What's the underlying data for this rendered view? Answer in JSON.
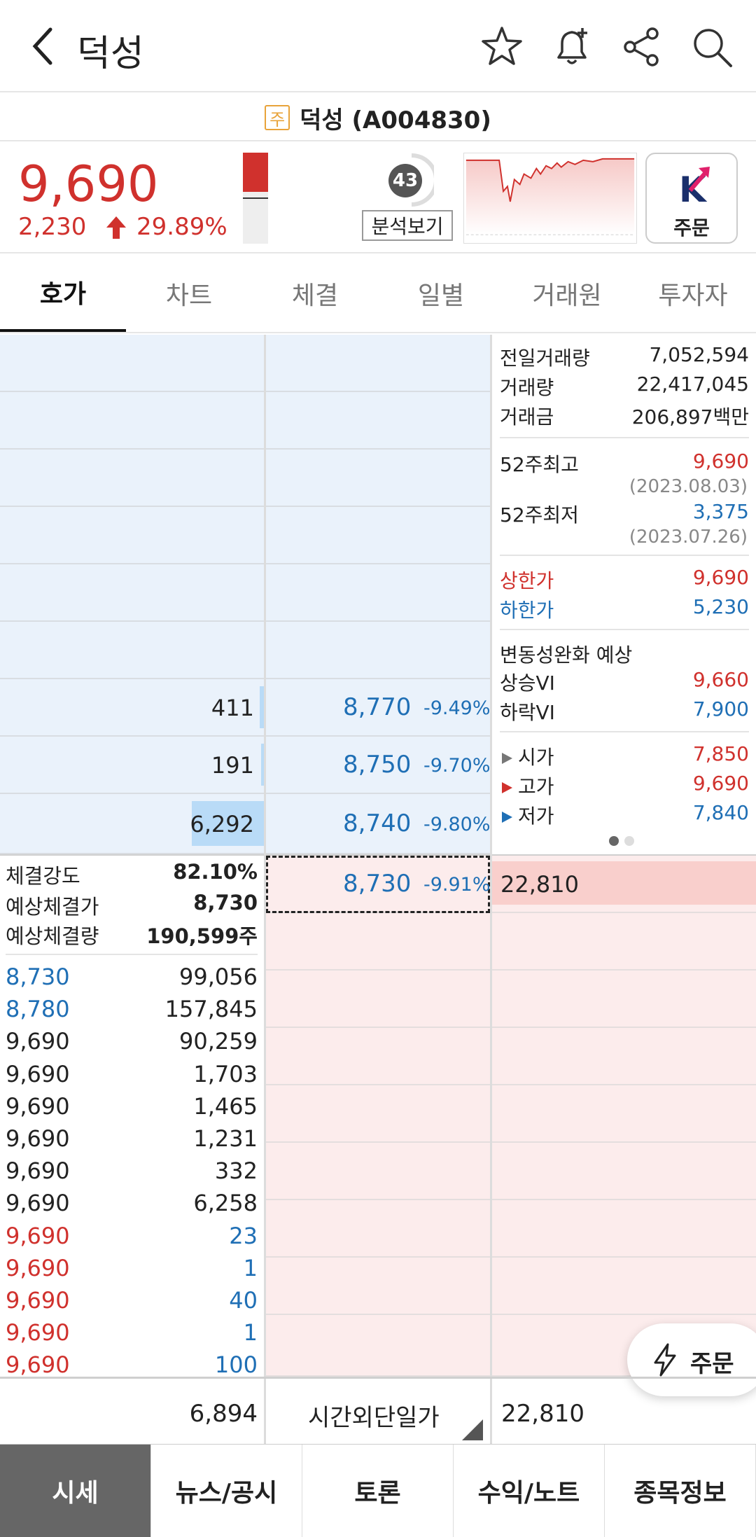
{
  "header": {
    "title": "덕성"
  },
  "namebar": {
    "badge": "주",
    "name": "덕성 (A004830)"
  },
  "price": {
    "current": "9,690",
    "change": "2,230",
    "change_pct": "29.89%",
    "score": "43",
    "analysis_label": "분석보기",
    "order_label": "주문",
    "brand_color": "#d0312d"
  },
  "tabs": [
    "호가",
    "차트",
    "체결",
    "일별",
    "거래원",
    "투자자"
  ],
  "asks": [
    {
      "qty": "411",
      "price": "8,770",
      "pct": "-9.49%",
      "bar_fraction": 0.0
    },
    {
      "qty": "191",
      "price": "8,750",
      "pct": "-9.70%",
      "bar_fraction": 0.0
    },
    {
      "qty": "6,292",
      "price": "8,740",
      "pct": "-9.80%",
      "bar_fraction": 1.0
    }
  ],
  "current_row": {
    "price": "8,730",
    "pct": "-9.91%",
    "bid_qty": "22,810"
  },
  "info": {
    "prev_volume_label": "전일거래량",
    "prev_volume": "7,052,594",
    "volume_label": "거래량",
    "volume": "22,417,045",
    "amount_label": "거래금",
    "amount": "206,897백만",
    "high52_label": "52주최고",
    "high52": "9,690",
    "high52_date": "(2023.08.03)",
    "low52_label": "52주최저",
    "low52": "3,375",
    "low52_date": "(2023.07.26)",
    "upper_label": "상한가",
    "upper": "9,690",
    "lower_label": "하한가",
    "lower": "5,230",
    "vi_title": "변동성완화 예상",
    "vi_up_label": "상승VI",
    "vi_up": "9,660",
    "vi_down_label": "하락VI",
    "vi_down": "7,900",
    "open_label": "시가",
    "open": "7,850",
    "high_label": "고가",
    "high": "9,690",
    "low_label": "저가",
    "low": "7,840"
  },
  "stats": {
    "strength_label": "체결강도",
    "strength": "82.10%",
    "exp_price_label": "예상체결가",
    "exp_price": "8,730",
    "exp_qty_label": "예상체결량",
    "exp_qty": "190,599주"
  },
  "trades": [
    {
      "price": "8,730",
      "qty": "99,056",
      "price_color": "blue",
      "qty_color": "black"
    },
    {
      "price": "8,780",
      "qty": "157,845",
      "price_color": "blue",
      "qty_color": "black"
    },
    {
      "price": "9,690",
      "qty": "90,259",
      "price_color": "black",
      "qty_color": "black"
    },
    {
      "price": "9,690",
      "qty": "1,703",
      "price_color": "black",
      "qty_color": "black"
    },
    {
      "price": "9,690",
      "qty": "1,465",
      "price_color": "black",
      "qty_color": "black"
    },
    {
      "price": "9,690",
      "qty": "1,231",
      "price_color": "black",
      "qty_color": "black"
    },
    {
      "price": "9,690",
      "qty": "332",
      "price_color": "black",
      "qty_color": "black"
    },
    {
      "price": "9,690",
      "qty": "6,258",
      "price_color": "black",
      "qty_color": "black"
    },
    {
      "price": "9,690",
      "qty": "23",
      "price_color": "red",
      "qty_color": "blue"
    },
    {
      "price": "9,690",
      "qty": "1",
      "price_color": "red",
      "qty_color": "blue"
    },
    {
      "price": "9,690",
      "qty": "40",
      "price_color": "red",
      "qty_color": "blue"
    },
    {
      "price": "9,690",
      "qty": "1",
      "price_color": "red",
      "qty_color": "blue"
    },
    {
      "price": "9,690",
      "qty": "100",
      "price_color": "red",
      "qty_color": "blue"
    }
  ],
  "summary": {
    "ask_total": "6,894",
    "label": "시간외단일가",
    "bid_total": "22,810"
  },
  "fab_label": "주문",
  "bottom_nav": [
    "시세",
    "뉴스/공시",
    "토론",
    "수익/노트",
    "종목정보"
  ]
}
